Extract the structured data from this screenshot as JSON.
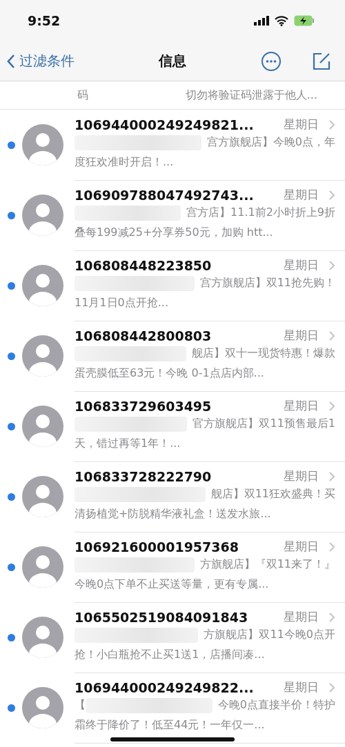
{
  "status_bar": {
    "time": "9:52"
  },
  "nav": {
    "back_label": "过滤条件",
    "title": "信息"
  },
  "partial_row": {
    "line_start": "码",
    "line_end": "切勿将验证码泄露于他人..."
  },
  "messages": [
    {
      "sender": "106944000249249821...",
      "date": "星期日",
      "unread": true,
      "line1": "宫方旗舰店】今晚0点，年",
      "line2": "度狂欢准时开启！..."
    },
    {
      "sender": "106909788047492743...",
      "date": "星期日",
      "unread": true,
      "line1": "宫方店】11.1前2小时折上9折",
      "line2": "叠每199减25+分享券50元，加购 htt..."
    },
    {
      "sender": "106808448223850",
      "date": "星期日",
      "unread": true,
      "line1": "宫方旗舰店】双11抢先购！",
      "line2": "11月1日0点开抢..."
    },
    {
      "sender": "106808442800803",
      "date": "星期日",
      "unread": true,
      "line1": "舰店】双十一现货特惠！爆款",
      "line2": "蛋壳膜低至63元！今晚 0-1点店内部..."
    },
    {
      "sender": "106833729603495",
      "date": "星期日",
      "unread": true,
      "line1": "官方旗舰店】双11预售最后1",
      "line2": "天，错过再等1年！..."
    },
    {
      "sender": "106833728222790",
      "date": "星期日",
      "unread": true,
      "line1": "舰店】双11狂欢盛典！买",
      "line2": "清扬植觉+防脱精华液礼盒！送发水旅..."
    },
    {
      "sender": "106921600001957368",
      "date": "星期日",
      "unread": true,
      "line1": "方旗舰店】『双11来了！』",
      "line2": "今晚0点下单不止买送等量，更有专属..."
    },
    {
      "sender": "1065502519084091843",
      "date": "星期日",
      "unread": true,
      "line1": "方旗舰店】双11今晚0点开",
      "line2": "抢！小白瓶抢不止买1送1，店播间凑..."
    },
    {
      "sender": "106944000249249822...",
      "date": "星期日",
      "unread": true,
      "lead": "【",
      "line1": "今晚0点直接半价！特护",
      "line2": "霜终于降价了！低至44元！一年仅一..."
    }
  ]
}
